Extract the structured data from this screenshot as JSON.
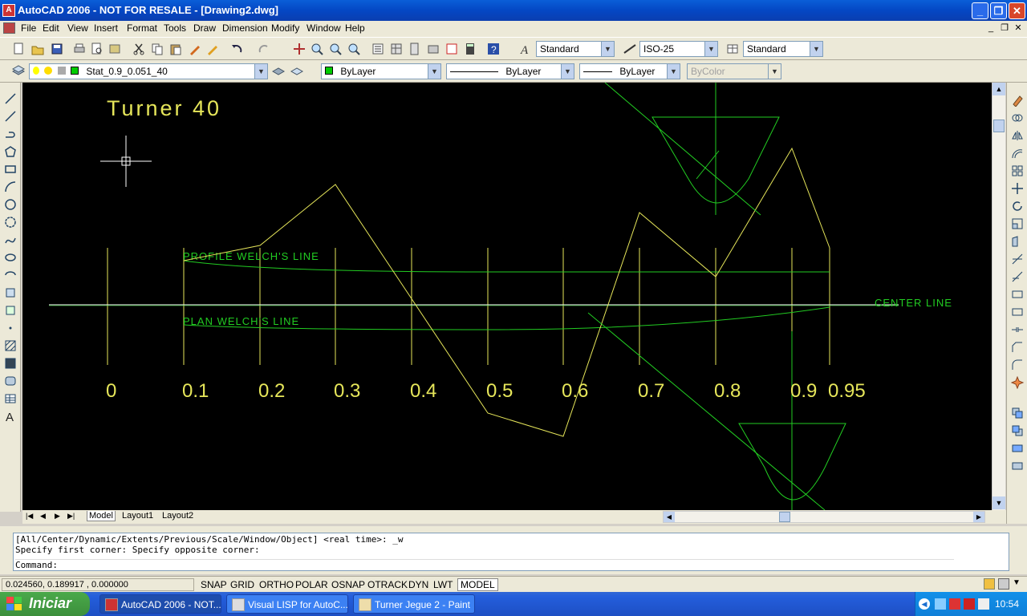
{
  "window": {
    "title": "AutoCAD 2006 - NOT FOR RESALE - [Drawing2.dwg]"
  },
  "menu": [
    "File",
    "Edit",
    "View",
    "Insert",
    "Format",
    "Tools",
    "Draw",
    "Dimension",
    "Modify",
    "Window",
    "Help"
  ],
  "toolbar": {
    "text_style": "Standard",
    "dim_style": "ISO-25",
    "table_style": "Standard"
  },
  "layers": {
    "current_layer": "Stat_0.9_0.051_40",
    "color": "ByLayer",
    "linetype": "ByLayer",
    "lineweight": "ByLayer",
    "plotstyle": "ByColor"
  },
  "drawing": {
    "title": "Turner 40",
    "profile_label": "PROFILE WELCH'S LINE",
    "plan_label": "PLAN WELCH'S LINE",
    "center_label": "CENTER LINE",
    "stations": [
      "0",
      "0.1",
      "0.2",
      "0.3",
      "0.4",
      "0.5",
      "0.6",
      "0.7",
      "0.8",
      "0.9",
      "0.95"
    ],
    "colors": {
      "green": "#22cc22",
      "yellow": "#e6e65a",
      "background": "#000000"
    }
  },
  "layout_tabs": [
    "Model",
    "Layout1",
    "Layout2"
  ],
  "command": {
    "line1": "[All/Center/Dynamic/Extents/Previous/Scale/Window/Object] <real time>: _w",
    "line2": "Specify first corner: Specify opposite corner:",
    "prompt": "Command:"
  },
  "status": {
    "coords": "0.024560, 0.189917 , 0.000000",
    "toggles": [
      "SNAP",
      "GRID",
      "ORTHO",
      "POLAR",
      "OSNAP",
      "OTRACK",
      "DYN",
      "LWT",
      "MODEL"
    ]
  },
  "taskbar": {
    "start": "Iniciar",
    "tasks": [
      "AutoCAD 2006 - NOT...",
      "Visual LISP for AutoC...",
      "Turner Jegue 2 - Paint"
    ],
    "clock": "10:54"
  }
}
